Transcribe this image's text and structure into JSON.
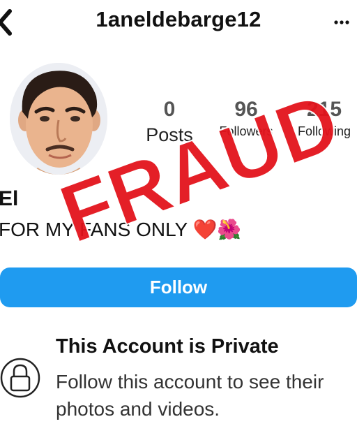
{
  "header": {
    "username": "1aneldebarge12"
  },
  "profile": {
    "stats": [
      {
        "value": "0",
        "label": "Posts"
      },
      {
        "value": "96",
        "label": "Followers"
      },
      {
        "value": "215",
        "label": "Following"
      }
    ],
    "name": "El",
    "bio": "FOR MY FANS ONLY ❤️🌺"
  },
  "actions": {
    "follow_label": "Follow"
  },
  "private": {
    "title": "This Account is Private",
    "text": "Follow this account to see their photos and videos."
  },
  "overlay": {
    "stamp_text": "FRAUD"
  },
  "colors": {
    "accent": "#1f9bf0",
    "stamp": "#e3141c"
  }
}
